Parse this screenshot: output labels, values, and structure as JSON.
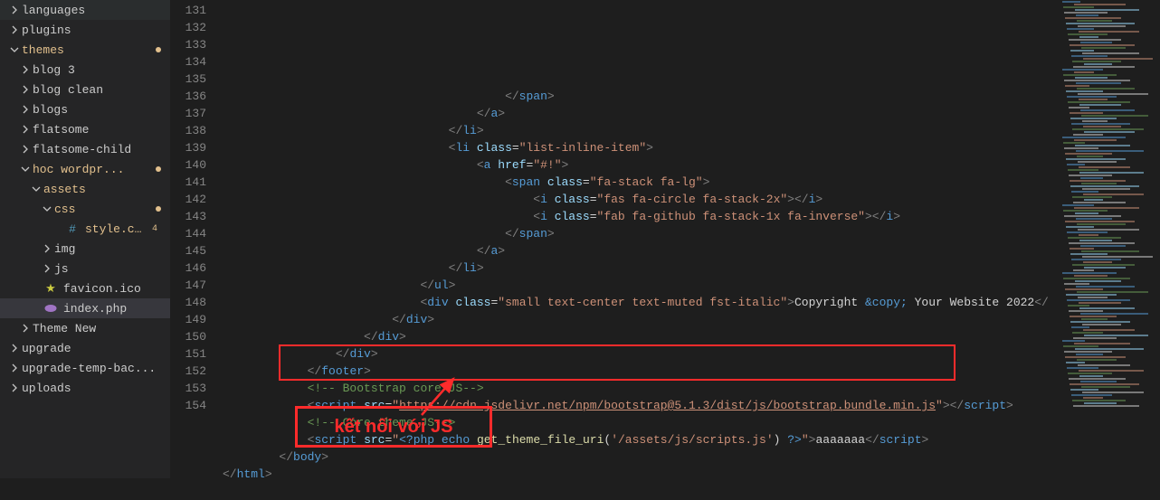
{
  "sidebar": {
    "items": [
      {
        "label": "languages",
        "indent": 0,
        "chev": "right",
        "type": "folder"
      },
      {
        "label": "plugins",
        "indent": 0,
        "chev": "right",
        "type": "folder"
      },
      {
        "label": "themes",
        "indent": 0,
        "chev": "down",
        "type": "folder",
        "modified": true,
        "dot": "#e2c08d"
      },
      {
        "label": "blog 3",
        "indent": 1,
        "chev": "right",
        "type": "folder"
      },
      {
        "label": "blog clean",
        "indent": 1,
        "chev": "right",
        "type": "folder"
      },
      {
        "label": "blogs",
        "indent": 1,
        "chev": "right",
        "type": "folder"
      },
      {
        "label": "flatsome",
        "indent": 1,
        "chev": "right",
        "type": "folder"
      },
      {
        "label": "flatsome-child",
        "indent": 1,
        "chev": "right",
        "type": "folder"
      },
      {
        "label": "hoc wordpr...",
        "indent": 1,
        "chev": "down",
        "type": "folder",
        "modified": true,
        "dot": "#e2c08d"
      },
      {
        "label": "assets",
        "indent": 2,
        "chev": "down",
        "type": "folder",
        "modified": true
      },
      {
        "label": "css",
        "indent": 3,
        "chev": "down",
        "type": "folder",
        "modified": true,
        "dot": "#e2c08d"
      },
      {
        "label": "style.css",
        "indent": 3,
        "chev": "none",
        "type": "file",
        "icon": "hash",
        "modified": true,
        "badge": "4",
        "extraIndent": true
      },
      {
        "label": "img",
        "indent": 3,
        "chev": "right",
        "type": "folder"
      },
      {
        "label": "js",
        "indent": 3,
        "chev": "right",
        "type": "folder"
      },
      {
        "label": "favicon.ico",
        "indent": 2,
        "chev": "none",
        "type": "file",
        "icon": "star"
      },
      {
        "label": "index.php",
        "indent": 2,
        "chev": "none",
        "type": "file",
        "icon": "php",
        "selected": true
      },
      {
        "label": "Theme New",
        "indent": 1,
        "chev": "right",
        "type": "folder"
      },
      {
        "label": "upgrade",
        "indent": 0,
        "chev": "right",
        "type": "folder"
      },
      {
        "label": "upgrade-temp-bac...",
        "indent": 0,
        "chev": "right",
        "type": "folder"
      },
      {
        "label": "uploads",
        "indent": 0,
        "chev": "right",
        "type": "folder"
      }
    ]
  },
  "lineStart": 131,
  "lineEnd": 154,
  "code": {
    "lines": [
      {
        "n": 131,
        "i": 40,
        "h": [
          {
            "c": "p",
            "t": "</"
          },
          {
            "c": "t",
            "t": "span"
          },
          {
            "c": "p",
            "t": ">"
          }
        ]
      },
      {
        "n": 132,
        "i": 36,
        "h": [
          {
            "c": "p",
            "t": "</"
          },
          {
            "c": "t",
            "t": "a"
          },
          {
            "c": "p",
            "t": ">"
          }
        ]
      },
      {
        "n": 133,
        "i": 32,
        "h": [
          {
            "c": "p",
            "t": "</"
          },
          {
            "c": "t",
            "t": "li"
          },
          {
            "c": "p",
            "t": ">"
          }
        ]
      },
      {
        "n": 134,
        "i": 32,
        "h": [
          {
            "c": "p",
            "t": "<"
          },
          {
            "c": "t",
            "t": "li"
          },
          {
            "c": "txt",
            "t": " "
          },
          {
            "c": "attr",
            "t": "class"
          },
          {
            "c": "txt",
            "t": "="
          },
          {
            "c": "str",
            "t": "\"list-inline-item\""
          },
          {
            "c": "p",
            "t": ">"
          }
        ]
      },
      {
        "n": 135,
        "i": 36,
        "h": [
          {
            "c": "p",
            "t": "<"
          },
          {
            "c": "t",
            "t": "a"
          },
          {
            "c": "txt",
            "t": " "
          },
          {
            "c": "attr",
            "t": "href"
          },
          {
            "c": "txt",
            "t": "="
          },
          {
            "c": "str",
            "t": "\"#!\""
          },
          {
            "c": "p",
            "t": ">"
          }
        ]
      },
      {
        "n": 136,
        "i": 40,
        "h": [
          {
            "c": "p",
            "t": "<"
          },
          {
            "c": "t",
            "t": "span"
          },
          {
            "c": "txt",
            "t": " "
          },
          {
            "c": "attr",
            "t": "class"
          },
          {
            "c": "txt",
            "t": "="
          },
          {
            "c": "str",
            "t": "\"fa-stack fa-lg\""
          },
          {
            "c": "p",
            "t": ">"
          }
        ]
      },
      {
        "n": 137,
        "i": 44,
        "h": [
          {
            "c": "p",
            "t": "<"
          },
          {
            "c": "t",
            "t": "i"
          },
          {
            "c": "txt",
            "t": " "
          },
          {
            "c": "attr",
            "t": "class"
          },
          {
            "c": "txt",
            "t": "="
          },
          {
            "c": "str",
            "t": "\"fas fa-circle fa-stack-2x\""
          },
          {
            "c": "p",
            "t": "></"
          },
          {
            "c": "t",
            "t": "i"
          },
          {
            "c": "p",
            "t": ">"
          }
        ]
      },
      {
        "n": 138,
        "i": 44,
        "h": [
          {
            "c": "p",
            "t": "<"
          },
          {
            "c": "t",
            "t": "i"
          },
          {
            "c": "txt",
            "t": " "
          },
          {
            "c": "attr",
            "t": "class"
          },
          {
            "c": "txt",
            "t": "="
          },
          {
            "c": "str",
            "t": "\"fab fa-github fa-stack-1x fa-inverse\""
          },
          {
            "c": "p",
            "t": "></"
          },
          {
            "c": "t",
            "t": "i"
          },
          {
            "c": "p",
            "t": ">"
          }
        ]
      },
      {
        "n": 139,
        "i": 40,
        "h": [
          {
            "c": "p",
            "t": "</"
          },
          {
            "c": "t",
            "t": "span"
          },
          {
            "c": "p",
            "t": ">"
          }
        ]
      },
      {
        "n": 140,
        "i": 36,
        "h": [
          {
            "c": "p",
            "t": "</"
          },
          {
            "c": "t",
            "t": "a"
          },
          {
            "c": "p",
            "t": ">"
          }
        ]
      },
      {
        "n": 141,
        "i": 32,
        "h": [
          {
            "c": "p",
            "t": "</"
          },
          {
            "c": "t",
            "t": "li"
          },
          {
            "c": "p",
            "t": ">"
          }
        ]
      },
      {
        "n": 142,
        "i": 28,
        "h": [
          {
            "c": "p",
            "t": "</"
          },
          {
            "c": "t",
            "t": "ul"
          },
          {
            "c": "p",
            "t": ">"
          }
        ]
      },
      {
        "n": 143,
        "i": 28,
        "h": [
          {
            "c": "p",
            "t": "<"
          },
          {
            "c": "t",
            "t": "div"
          },
          {
            "c": "txt",
            "t": " "
          },
          {
            "c": "attr",
            "t": "class"
          },
          {
            "c": "txt",
            "t": "="
          },
          {
            "c": "str",
            "t": "\"small text-center text-muted fst-italic\""
          },
          {
            "c": "p",
            "t": ">"
          },
          {
            "c": "txt",
            "t": "Copyright "
          },
          {
            "c": "t",
            "t": "&copy;"
          },
          {
            "c": "txt",
            "t": " Your Website 2022"
          },
          {
            "c": "p",
            "t": "</"
          }
        ]
      },
      {
        "n": 144,
        "i": 24,
        "h": [
          {
            "c": "p",
            "t": "</"
          },
          {
            "c": "t",
            "t": "div"
          },
          {
            "c": "p",
            "t": ">"
          }
        ]
      },
      {
        "n": 145,
        "i": 20,
        "h": [
          {
            "c": "p",
            "t": "</"
          },
          {
            "c": "t",
            "t": "div"
          },
          {
            "c": "p",
            "t": ">"
          }
        ]
      },
      {
        "n": 146,
        "i": 16,
        "h": [
          {
            "c": "p",
            "t": "</"
          },
          {
            "c": "t",
            "t": "div"
          },
          {
            "c": "p",
            "t": ">"
          }
        ]
      },
      {
        "n": 147,
        "i": 12,
        "h": [
          {
            "c": "p",
            "t": "</"
          },
          {
            "c": "t",
            "t": "footer"
          },
          {
            "c": "p",
            "t": ">"
          }
        ]
      },
      {
        "n": 148,
        "i": 12,
        "h": [
          {
            "c": "cmt",
            "t": "<!-- Bootstrap core JS-->"
          }
        ]
      },
      {
        "n": 149,
        "i": 12,
        "h": [
          {
            "c": "p",
            "t": "<"
          },
          {
            "c": "t",
            "t": "script"
          },
          {
            "c": "txt",
            "t": " "
          },
          {
            "c": "attr",
            "t": "src"
          },
          {
            "c": "txt",
            "t": "="
          },
          {
            "c": "str",
            "t": "\""
          },
          {
            "c": "url",
            "t": "https://cdn.jsdelivr.net/npm/bootstrap@5.1.3/dist/js/bootstrap.bundle.min.js"
          },
          {
            "c": "str",
            "t": "\""
          },
          {
            "c": "p",
            "t": "></"
          },
          {
            "c": "t",
            "t": "script"
          },
          {
            "c": "p",
            "t": ">"
          }
        ]
      },
      {
        "n": 150,
        "i": 12,
        "h": [
          {
            "c": "cmt",
            "t": "<!-- Core theme JS-->"
          }
        ]
      },
      {
        "n": 151,
        "i": 12,
        "h": [
          {
            "c": "p",
            "t": "<"
          },
          {
            "c": "t",
            "t": "script"
          },
          {
            "c": "txt",
            "t": " "
          },
          {
            "c": "attr",
            "t": "src"
          },
          {
            "c": "txt",
            "t": "="
          },
          {
            "c": "str",
            "t": "\""
          },
          {
            "c": "php",
            "t": "<?php"
          },
          {
            "c": "txt",
            "t": " "
          },
          {
            "c": "php",
            "t": "echo"
          },
          {
            "c": "txt",
            "t": " "
          },
          {
            "c": "phpf",
            "t": "get_theme_file_uri"
          },
          {
            "c": "txt",
            "t": "("
          },
          {
            "c": "str",
            "t": "'/assets/js/scripts.js'"
          },
          {
            "c": "txt",
            "t": ") "
          },
          {
            "c": "php",
            "t": "?>"
          },
          {
            "c": "str",
            "t": "\""
          },
          {
            "c": "p",
            "t": ">"
          },
          {
            "c": "txt",
            "t": "aaaaaaa"
          },
          {
            "c": "p",
            "t": "</"
          },
          {
            "c": "t",
            "t": "script"
          },
          {
            "c": "p",
            "t": ">"
          }
        ]
      },
      {
        "n": 152,
        "i": 8,
        "h": [
          {
            "c": "p",
            "t": "</"
          },
          {
            "c": "t",
            "t": "body"
          },
          {
            "c": "p",
            "t": ">"
          }
        ]
      },
      {
        "n": 153,
        "i": 0,
        "h": [
          {
            "c": "p",
            "t": "</"
          },
          {
            "c": "t",
            "t": "html"
          },
          {
            "c": "p",
            "t": ">"
          }
        ]
      },
      {
        "n": 154,
        "i": 0,
        "h": []
      }
    ]
  },
  "annotation": {
    "text": "kết nối với JS"
  }
}
